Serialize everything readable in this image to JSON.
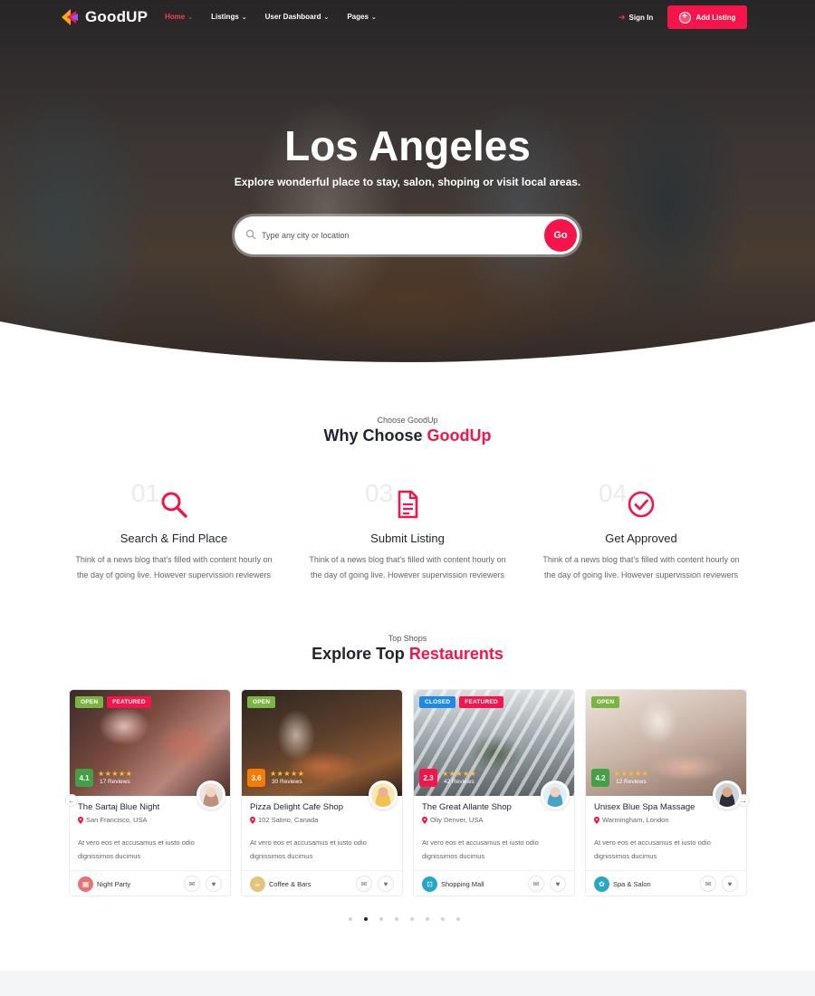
{
  "brand": {
    "name": "GoodUP"
  },
  "nav": {
    "items": [
      {
        "label": "Home",
        "active": true
      },
      {
        "label": "Listings",
        "active": false
      },
      {
        "label": "User Dashboard",
        "active": false
      },
      {
        "label": "Pages",
        "active": false
      }
    ],
    "sign_in": "Sign In",
    "add_listing": "Add Listing"
  },
  "hero": {
    "title": "Los Angeles",
    "subtitle": "Explore wonderful place to stay, salon, shoping or visit local areas.",
    "search_placeholder": "Type any city or location",
    "go_label": "Go"
  },
  "why": {
    "kicker": "Choose GoodUp",
    "title_plain": "Why Choose",
    "title_accent": "GoodUp",
    "features": [
      {
        "num": "01",
        "title": "Search & Find Place",
        "text": "Think of a news blog that's filled with content hourly on the day of going live. However supervission reviewers",
        "icon": "search-icon"
      },
      {
        "num": "03",
        "title": "Submit Listing",
        "text": "Think of a news blog that's filled with content hourly on the day of going live. However supervission reviewers",
        "icon": "document-icon"
      },
      {
        "num": "04",
        "title": "Get Approved",
        "text": "Think of a news blog that's filled with content hourly on the day of going live. However supervission reviewers",
        "icon": "check-circle-icon"
      }
    ]
  },
  "shops": {
    "kicker": "Top Shops",
    "title_plain": "Explore Top",
    "title_accent": "Restaurents",
    "cards": [
      {
        "tags": [
          "OPEN",
          "FEATURED"
        ],
        "rating": "4.1",
        "rating_color": "#43a047",
        "reviews": "17 Reviews",
        "title": "The Sartaj Blue Night",
        "location": "San Francisco, USA",
        "desc": "At vero eos et accusamus et iusto odio dignissimos ducimus",
        "category": "Night Party",
        "cat_color": "#e57373",
        "cat_icon": "calendar-icon"
      },
      {
        "tags": [
          "OPEN"
        ],
        "rating": "3.6",
        "rating_color": "#f57c00",
        "reviews": "30 Reviews",
        "title": "Pizza Delight Cafe Shop",
        "location": "102 Satirio, Canada",
        "desc": "At vero eos et accusamus et iusto odio dignissimos ducimus",
        "category": "Coffee & Bars",
        "cat_color": "#e6c27a",
        "cat_icon": "coffee-icon"
      },
      {
        "tags": [
          "CLOSED",
          "FEATURED"
        ],
        "rating": "2.3",
        "rating_color": "#f5154a",
        "reviews": "42 Reviews",
        "title": "The Great Allante Shop",
        "location": "Oliy Denver, USA",
        "desc": "At vero eos et accusamus et iusto odio dignissimos ducimus",
        "category": "Shopping Mall",
        "cat_color": "#26a7c8",
        "cat_icon": "bag-icon"
      },
      {
        "tags": [
          "OPEN"
        ],
        "rating": "4.2",
        "rating_color": "#43a047",
        "reviews": "12 Reviews",
        "title": "Unisex Blue Spa Massage",
        "location": "Warmingham, London",
        "desc": "At vero eos et accusamus et iusto odio dignissimos ducimus",
        "category": "Spa & Salon",
        "cat_color": "#26a7c8",
        "cat_icon": "spa-icon"
      }
    ],
    "dots": 8,
    "active_dot": 1
  },
  "colors": {
    "accent": "#f5154a",
    "dark": "#1f2430"
  }
}
